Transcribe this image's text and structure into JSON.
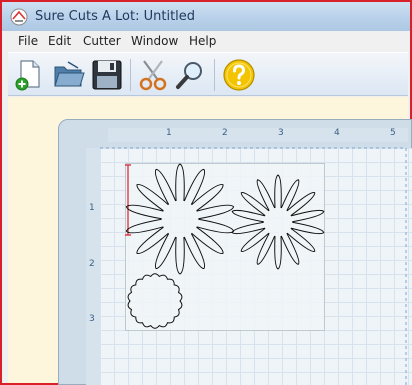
{
  "window": {
    "title": "Sure Cuts A Lot: Untitled",
    "border_color": "#d8202a"
  },
  "menu": {
    "items": [
      "File",
      "Edit",
      "Cutter",
      "Window",
      "Help"
    ]
  },
  "toolbar": {
    "tools": [
      {
        "name": "new-document-icon"
      },
      {
        "name": "open-folder-icon"
      },
      {
        "name": "save-icon"
      },
      {
        "name": "scissors-icon"
      },
      {
        "name": "zoom-icon"
      },
      {
        "name": "help-icon"
      }
    ]
  },
  "ruler": {
    "top_labels": [
      "1",
      "2",
      "3",
      "4",
      "5"
    ],
    "left_labels": [
      "1",
      "2",
      "3"
    ]
  },
  "colors": {
    "workspace": "#fdf6dc",
    "mat": "#eef4f8",
    "selection_marker": "#d8202a"
  }
}
